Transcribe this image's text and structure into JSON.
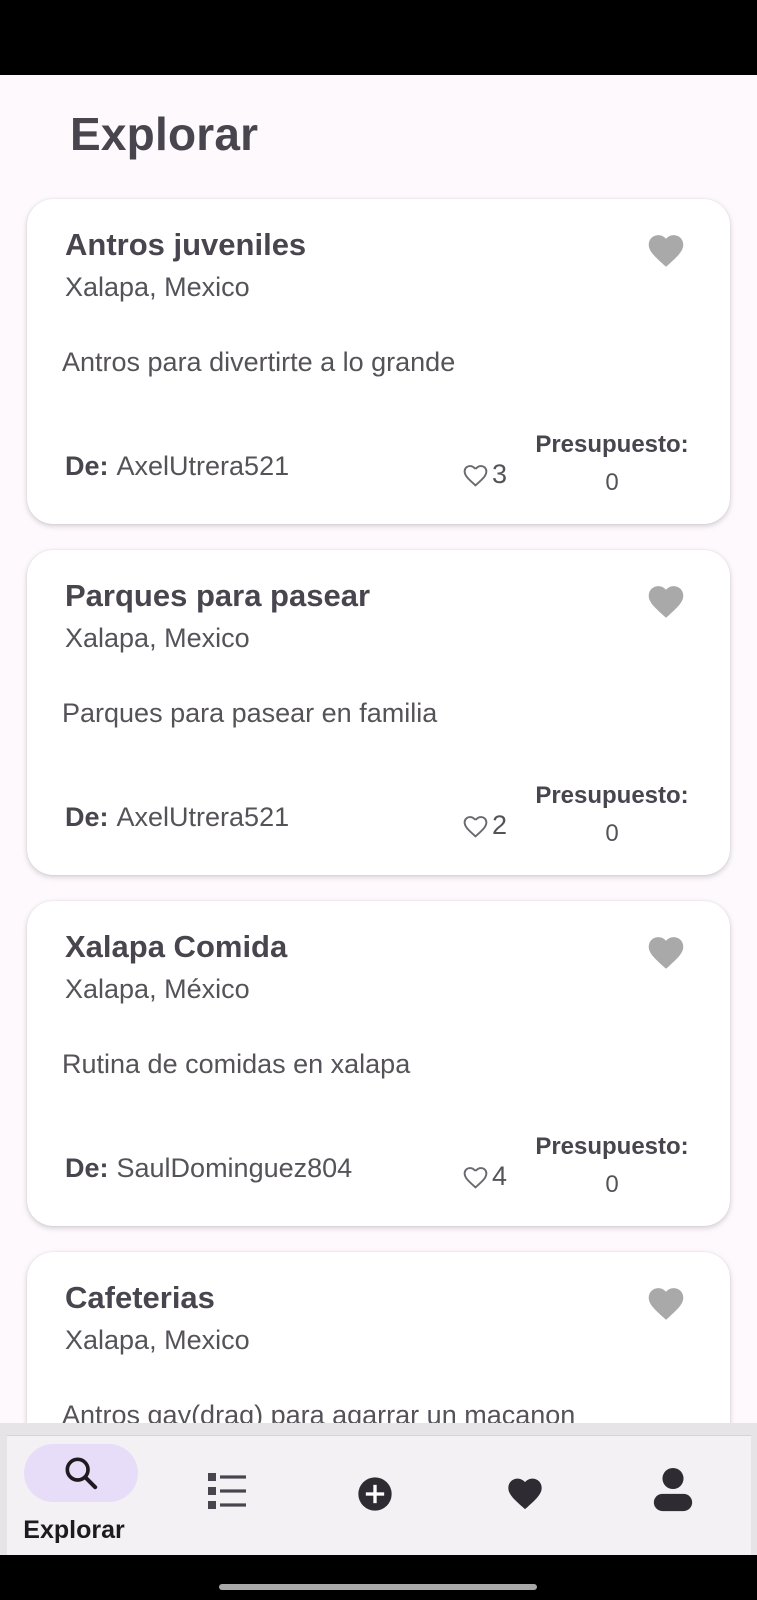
{
  "page": {
    "title": "Explorar"
  },
  "labels": {
    "author_prefix": "De:",
    "budget_label": "Presupuesto:"
  },
  "plans": [
    {
      "title": "Antros juveniles",
      "location": "Xalapa, Mexico",
      "description": "Antros para divertirte a lo grande",
      "author": "AxelUtrera521",
      "likes": "3",
      "budget": "0"
    },
    {
      "title": "Parques para pasear",
      "location": "Xalapa, Mexico",
      "description": "Parques para pasear en familia",
      "author": "AxelUtrera521",
      "likes": "2",
      "budget": "0"
    },
    {
      "title": "Xalapa Comida",
      "location": "Xalapa, México",
      "description": "Rutina de comidas en xalapa",
      "author": "SaulDominguez804",
      "likes": "4",
      "budget": "0"
    },
    {
      "title": "Cafeterias",
      "location": "Xalapa, Mexico",
      "description": "Antros gay(drag) para agarrar un macanon"
    }
  ],
  "nav": {
    "items": [
      {
        "label": "Explorar",
        "icon": "search-icon",
        "active": true
      },
      {
        "icon": "list-icon"
      },
      {
        "icon": "add-circle-icon"
      },
      {
        "icon": "heart-icon"
      },
      {
        "icon": "person-icon"
      }
    ]
  },
  "colors": {
    "background": "#fef9fd",
    "card": "#ffffff",
    "text": "#48454e",
    "favorite_icon": "#a9a9a9",
    "nav_active_pill": "#e7ddf8"
  }
}
